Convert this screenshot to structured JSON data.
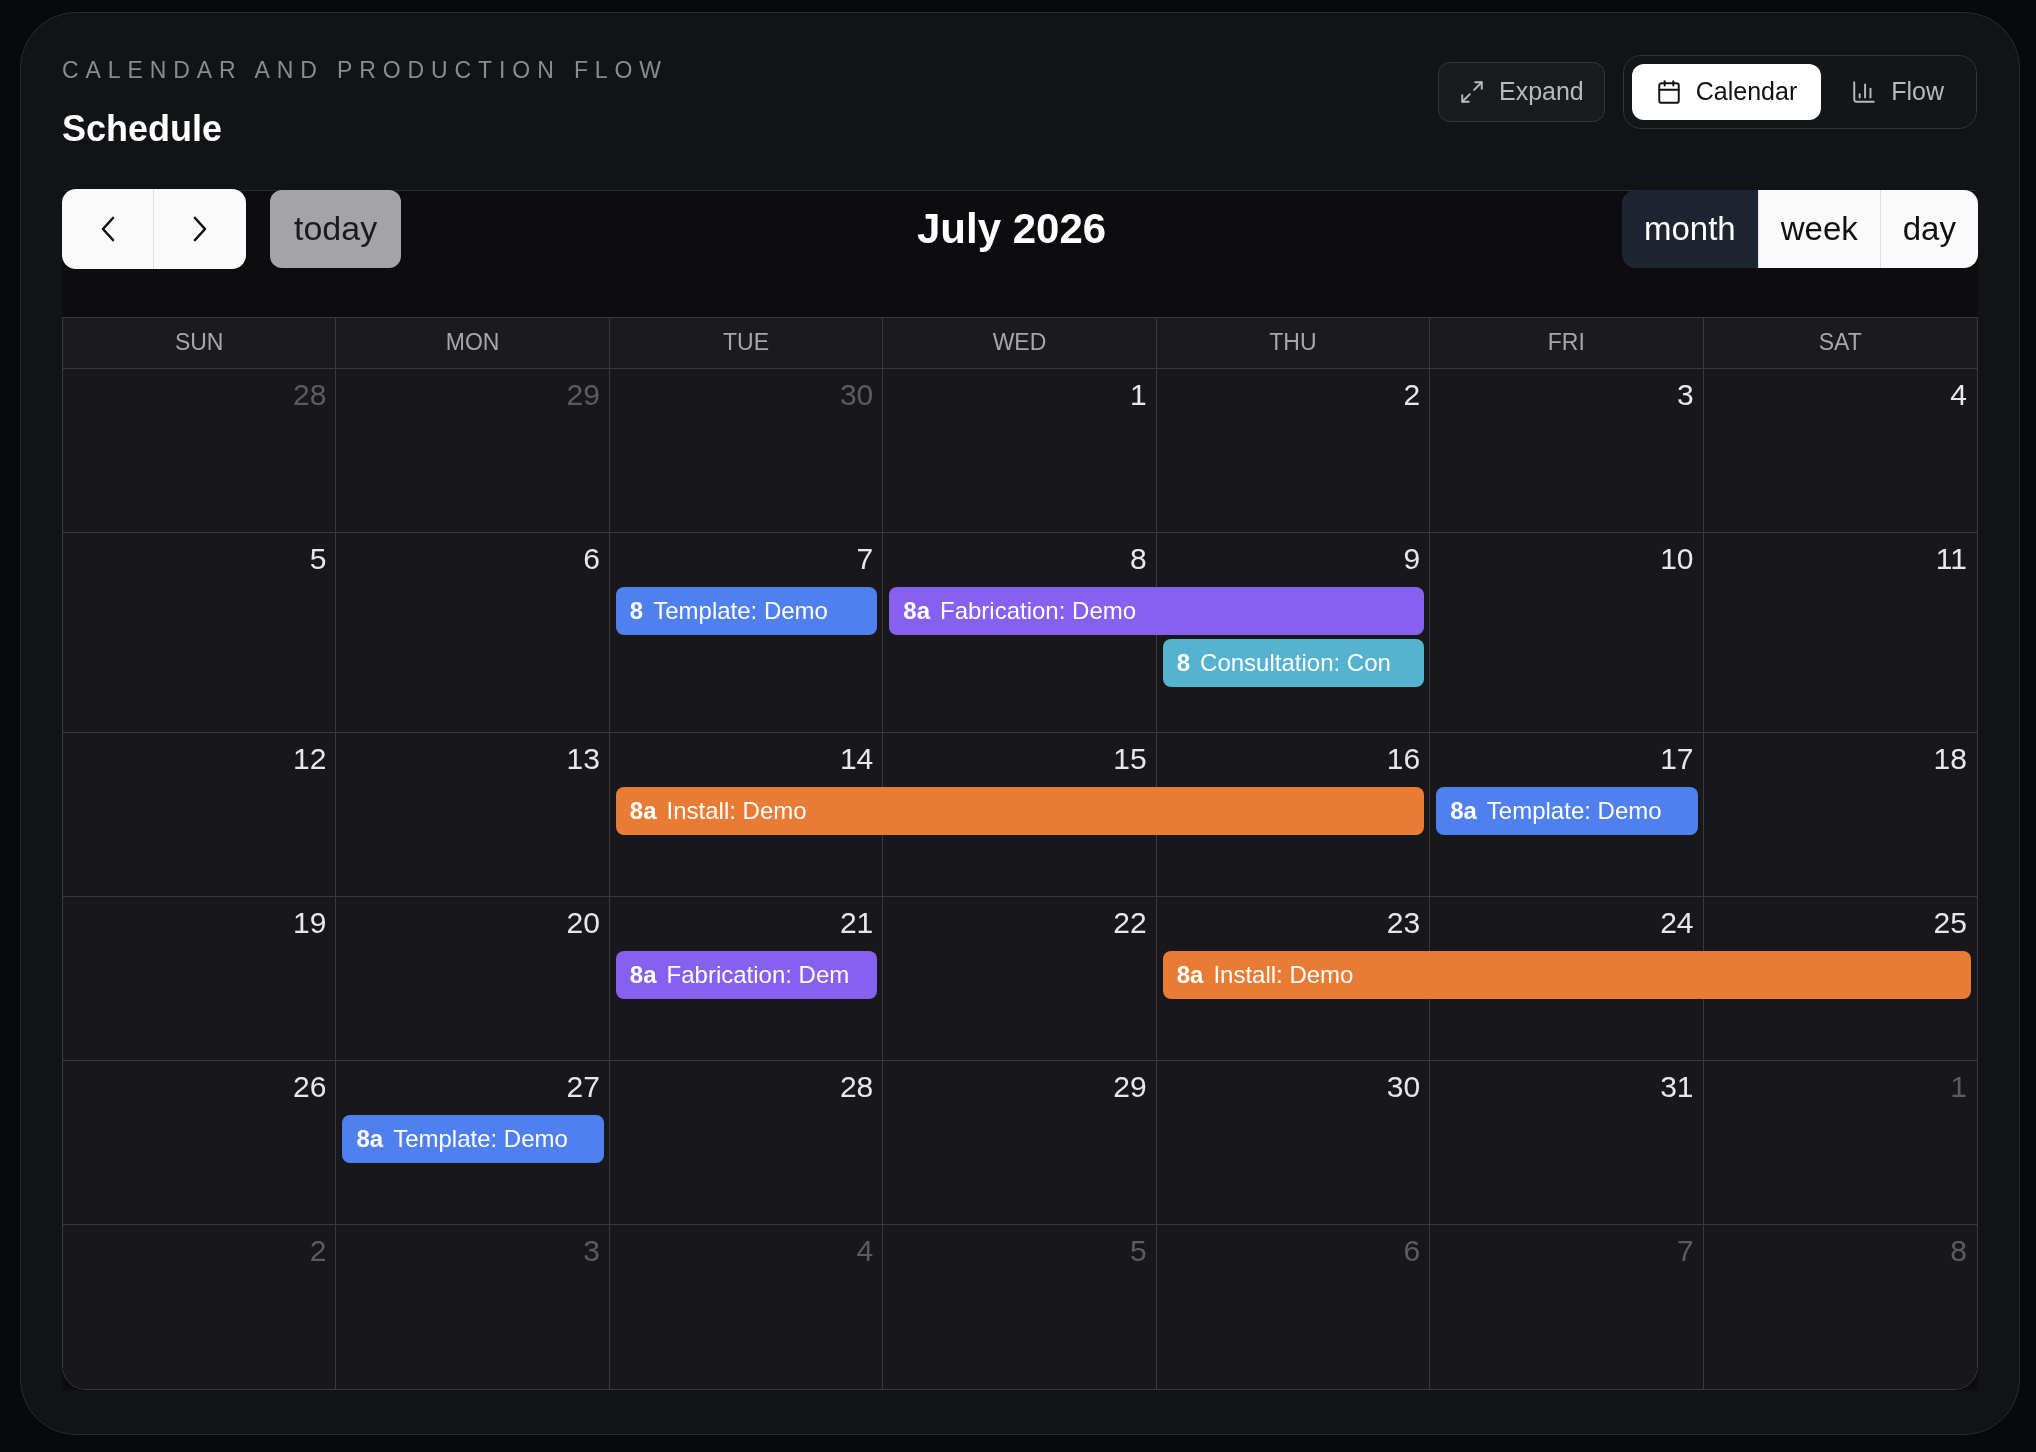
{
  "header": {
    "eyebrow": "CALENDAR AND PRODUCTION FLOW",
    "title": "Schedule"
  },
  "expand_button": {
    "label": "Expand"
  },
  "view_tabs": [
    {
      "label": "Calendar",
      "selected": true
    },
    {
      "label": "Flow",
      "selected": false
    }
  ],
  "toolbar": {
    "today": "today",
    "title": "July 2026",
    "modes": [
      {
        "label": "month",
        "selected": true
      },
      {
        "label": "week",
        "selected": false
      },
      {
        "label": "day",
        "selected": false
      }
    ]
  },
  "weekdays": [
    "SUN",
    "MON",
    "TUE",
    "WED",
    "THU",
    "FRI",
    "SAT"
  ],
  "weeks": [
    {
      "days": [
        {
          "number": "28",
          "other_month": true
        },
        {
          "number": "29",
          "other_month": true
        },
        {
          "number": "30",
          "other_month": true
        },
        {
          "number": "1",
          "other_month": false
        },
        {
          "number": "2",
          "other_month": false
        },
        {
          "number": "3",
          "other_month": false
        },
        {
          "number": "4",
          "other_month": false
        }
      ]
    },
    {
      "days": [
        {
          "number": "5",
          "other_month": false
        },
        {
          "number": "6",
          "other_month": false
        },
        {
          "number": "7",
          "other_month": false,
          "events": [
            {
              "time": "8",
              "title": "Template: Demo",
              "color": "#4f80ee",
              "kind": "single"
            }
          ]
        },
        {
          "number": "8",
          "other_month": false,
          "events": [
            {
              "time": "8a",
              "title": "Fabrication: Demo",
              "color": "#8660ee",
              "kind": "double"
            }
          ]
        },
        {
          "number": "9",
          "other_month": false,
          "events": [
            {
              "time": "8",
              "title": "Consultation: Con",
              "color": "#55b3d0",
              "kind": "single"
            }
          ]
        },
        {
          "number": "10",
          "other_month": false
        },
        {
          "number": "11",
          "other_month": false
        }
      ]
    },
    {
      "days": [
        {
          "number": "12",
          "other_month": false
        },
        {
          "number": "13",
          "other_month": false
        },
        {
          "number": "14",
          "other_month": false,
          "events": [
            {
              "time": "8a",
              "title": "Install: Demo",
              "color": "#e87c35",
              "kind": "triple"
            }
          ]
        },
        {
          "number": "15",
          "other_month": false
        },
        {
          "number": "16",
          "other_month": false
        },
        {
          "number": "17",
          "other_month": false,
          "events": [
            {
              "time": "8a",
              "title": "Template: Demo",
              "color": "#4f80ee",
              "kind": "single"
            }
          ]
        },
        {
          "number": "18",
          "other_month": false
        }
      ]
    },
    {
      "days": [
        {
          "number": "19",
          "other_month": false
        },
        {
          "number": "20",
          "other_month": false
        },
        {
          "number": "21",
          "other_month": false,
          "events": [
            {
              "time": "8a",
              "title": "Fabrication: Dem",
              "color": "#8660ee",
              "kind": "single"
            }
          ]
        },
        {
          "number": "22",
          "other_month": false
        },
        {
          "number": "23",
          "other_month": false,
          "events": [
            {
              "time": "8a",
              "title": "Install: Demo",
              "color": "#e87c35",
              "kind": "triple"
            }
          ]
        },
        {
          "number": "24",
          "other_month": false
        },
        {
          "number": "25",
          "other_month": false
        }
      ]
    },
    {
      "days": [
        {
          "number": "26",
          "other_month": false
        },
        {
          "number": "27",
          "other_month": false,
          "events": [
            {
              "time": "8a",
              "title": "Template: Demo",
              "color": "#4f80ee",
              "kind": "single"
            }
          ]
        },
        {
          "number": "28",
          "other_month": false
        },
        {
          "number": "29",
          "other_month": false
        },
        {
          "number": "30",
          "other_month": false
        },
        {
          "number": "31",
          "other_month": false
        },
        {
          "number": "1",
          "other_month": true
        }
      ]
    },
    {
      "days": [
        {
          "number": "2",
          "other_month": true
        },
        {
          "number": "3",
          "other_month": true
        },
        {
          "number": "4",
          "other_month": true
        },
        {
          "number": "5",
          "other_month": true
        },
        {
          "number": "6",
          "other_month": true
        },
        {
          "number": "7",
          "other_month": true
        },
        {
          "number": "8",
          "other_month": true
        }
      ]
    }
  ]
}
